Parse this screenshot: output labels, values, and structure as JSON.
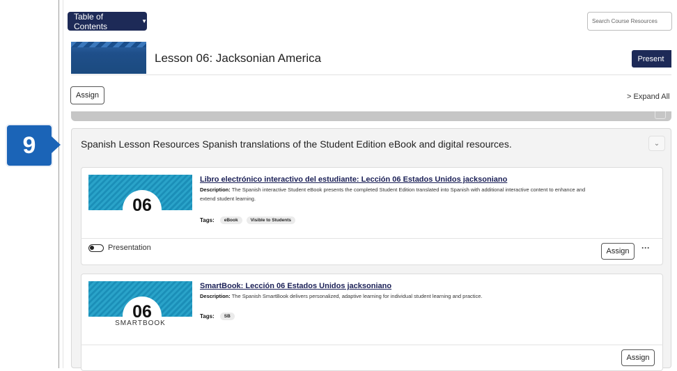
{
  "toolbar": {
    "toc_label": "Table of Contents",
    "search_placeholder": "Search Course Resources"
  },
  "lesson": {
    "title": "Lesson 06: Jacksonian America",
    "present_label": "Present",
    "assign_label": "Assign",
    "expand_all_label": "Expand All"
  },
  "step_badge": "9",
  "section": {
    "title": "Spanish Lesson Resources Spanish translations of the Student Edition eBook and digital resources."
  },
  "resources": [
    {
      "thumb_number": "06",
      "title": "Libro electrónico interactivo del estudiante: Lección 06 Estados Unidos jacksoniano",
      "description_label": "Description:",
      "description": " The Spanish interactive Student eBook presents the completed Student Edition translated into Spanish with additional interactive content to enhance and extend student learning.",
      "tags_label": "Tags:",
      "tags": [
        "eBook",
        "Visible to Students"
      ],
      "toggle_label": "Presentation",
      "assign_label": "Assign",
      "more_label": "···"
    },
    {
      "thumb_number": "06",
      "thumb_caption": "SMARTBOOK",
      "title": "SmartBook: Lección 06 Estados Unidos jacksoniano",
      "description_label": "Description:",
      "description": " The Spanish SmartBook delivers personalized, adaptive learning for individual student learning and practice.",
      "tags_label": "Tags:",
      "tags": [
        "SB"
      ],
      "assign_label": "Assign"
    }
  ],
  "colors": {
    "navy": "#1d2a57",
    "badge_blue": "#1b64b7",
    "thumb_teal": "#2aa3c9"
  }
}
